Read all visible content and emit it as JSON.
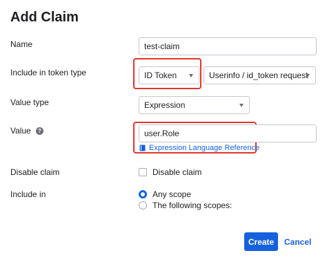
{
  "title": "Add Claim",
  "fields": {
    "name": {
      "label": "Name",
      "value": "test-claim"
    },
    "token_type": {
      "label": "Include in token type",
      "selected": "ID Token",
      "secondary": "Userinfo / id_token request"
    },
    "value_type": {
      "label": "Value type",
      "selected": "Expression"
    },
    "value": {
      "label": "Value",
      "help_icon": "?",
      "input": "user.Role",
      "link_icon": "book-icon",
      "link": "Expression Language Reference"
    },
    "disable_claim": {
      "label": "Disable claim",
      "checkbox_label": "Disable claim",
      "checked": false
    },
    "include_in": {
      "label": "Include in",
      "options": [
        "Any scope",
        "The following scopes:"
      ],
      "selected_index": 0
    }
  },
  "buttons": {
    "create": "Create",
    "cancel": "Cancel"
  },
  "colors": {
    "primary": "#1662dd",
    "highlight": "#e0352b"
  }
}
